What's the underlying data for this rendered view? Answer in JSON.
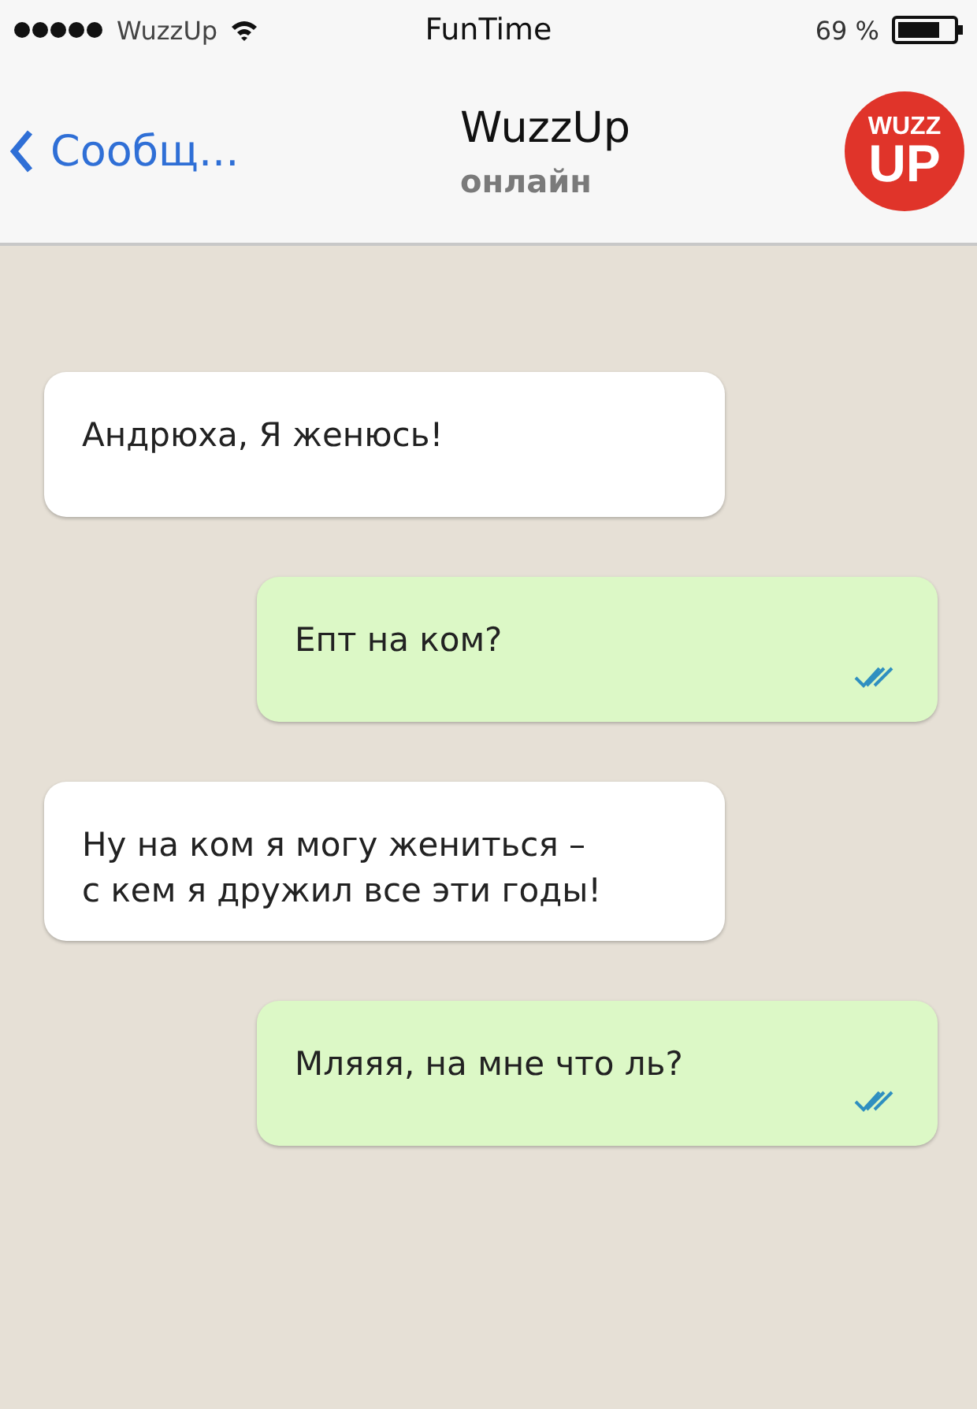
{
  "status_bar": {
    "carrier": "WuzzUp",
    "title": "FunTime",
    "battery": "69 %"
  },
  "nav": {
    "back": "Сообщ...",
    "title": "WuzzUp",
    "subtitle": "онлайн",
    "logo": {
      "top": "WUZZ",
      "bottom": "UP"
    }
  },
  "messages": [
    {
      "kind": "incoming",
      "text": "Андрюха, Я женюсь!"
    },
    {
      "kind": "outgoing",
      "text": "Епт на ком?",
      "read": true
    },
    {
      "kind": "incoming",
      "text": "Ну на ком я могу жениться –\nс кем я дружил все эти годы!"
    },
    {
      "kind": "outgoing",
      "text": "Мляяя, на мне что ль?",
      "read": true
    }
  ]
}
